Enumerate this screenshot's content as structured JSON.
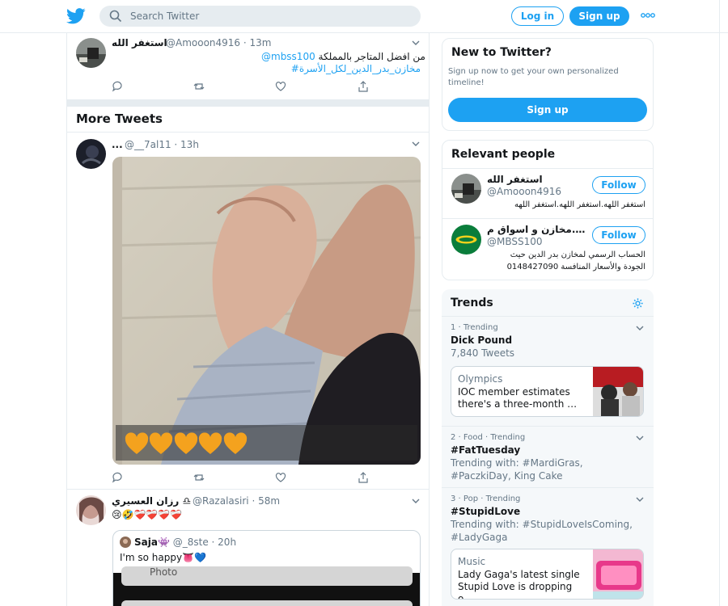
{
  "header": {
    "search_placeholder": "Search Twitter",
    "login_label": "Log in",
    "signup_label": "Sign up"
  },
  "tweet1": {
    "name": "استغفر الله",
    "handle": "@Amooon4916",
    "time": "· 13m",
    "text_line": "من افضل المتاجر بالمملكة",
    "mention": "@mbss100",
    "hashtag": "#مخازن_بدر_الدين_لكل_الأسرة"
  },
  "more_tweets_title": "More Tweets",
  "tweet2": {
    "name": "...",
    "handle": "@__7al11",
    "time": "· 13h"
  },
  "tweet3": {
    "name": "رزان العسيري ♎",
    "handle": "@Razalasiri",
    "time": "· 58m",
    "text": "😢🤣❤️‍🩹❤️‍🩹❤️‍🩹❤️‍🩹",
    "quote": {
      "name": "Saja👾",
      "handle": "@_8ste",
      "time": "· 20h",
      "text": "I'm so happy👅💙",
      "overlay_text": "Photo"
    }
  },
  "signup_card": {
    "title": "New to Twitter?",
    "text": "Sign up now to get your own personalized timeline!",
    "button": "Sign up"
  },
  "relevant": {
    "title": "Relevant people",
    "people": [
      {
        "name": "استغفر الله",
        "handle": "@Amooon4916",
        "bio": "استغفر اللهه.استغفر اللهه.استغفر اللهه",
        "follow": "Follow"
      },
      {
        "name": "مخازن و اسواق م.…",
        "handle": "@MBSS100",
        "bio_line1": "الحساب الرسمي لمخازن بدر الدين حيث",
        "bio_line2": "الجودة والأسعار المنافسة 0148427090",
        "follow": "Follow"
      }
    ]
  },
  "trends": {
    "title": "Trends",
    "items": [
      {
        "meta": "1 · Trending",
        "name": "Dick Pound",
        "sub": "7,840 Tweets",
        "card_cat": "Olympics",
        "card_desc": "IOC member estimates there's a three-month …"
      },
      {
        "meta": "2 · Food · Trending",
        "name": "#FatTuesday",
        "sub": "Trending with: #MardiGras, #PaczkiDay, King Cake"
      },
      {
        "meta": "3 · Pop · Trending",
        "name": "#StupidLove",
        "sub": "Trending with: #StupidLoveIsComing, #LadyGaga",
        "card_cat": "Music",
        "card_desc": "Lady Gaga's latest single Stupid Love is dropping o…"
      }
    ]
  },
  "colors": {
    "accent": "#1da1f2",
    "border": "#e6ecf0",
    "muted": "#657786"
  }
}
